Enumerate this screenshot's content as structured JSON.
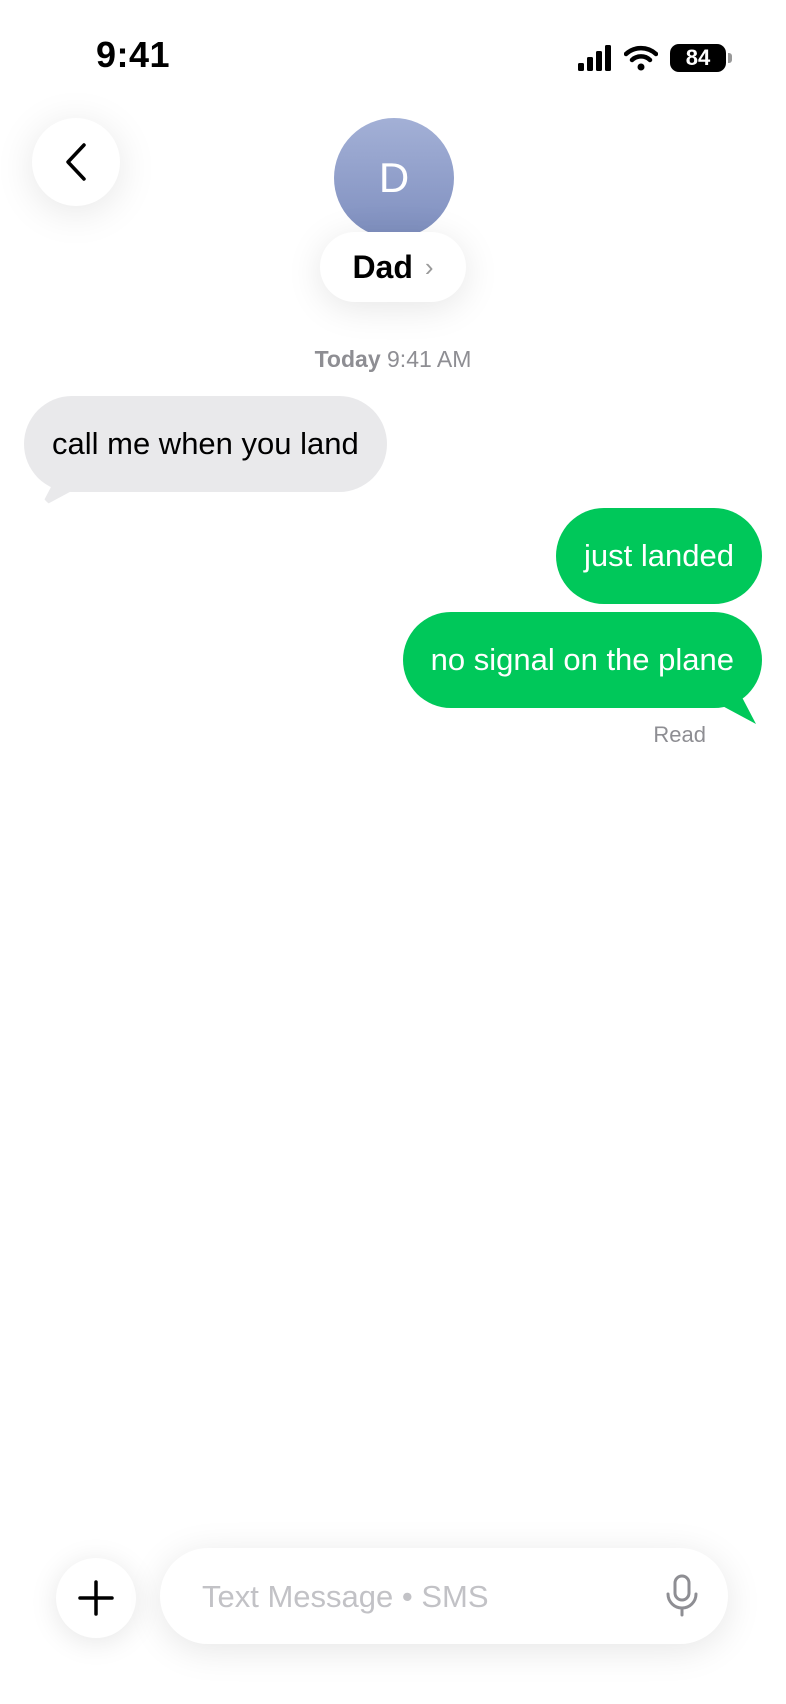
{
  "status_bar": {
    "time": "9:41",
    "battery": "84"
  },
  "header": {
    "avatar_initial": "D",
    "contact_name": "Dad",
    "chevron": "›"
  },
  "conversation": {
    "timestamp_day": "Today",
    "timestamp_time": "9:41 AM",
    "messages": [
      {
        "direction": "incoming",
        "text": "call me when you land"
      },
      {
        "direction": "outgoing",
        "text": "just landed"
      },
      {
        "direction": "outgoing",
        "text": "no signal on the plane"
      }
    ],
    "read_receipt": "Read"
  },
  "composer": {
    "placeholder": "Text Message • SMS"
  },
  "colors": {
    "outgoing_bubble": "#00c85a",
    "incoming_bubble": "#e9e9eb",
    "avatar": "#8f9cc9"
  },
  "icons": [
    "cellular-signal-icon",
    "wifi-icon",
    "battery-icon",
    "chevron-left-icon",
    "plus-icon",
    "microphone-icon"
  ]
}
